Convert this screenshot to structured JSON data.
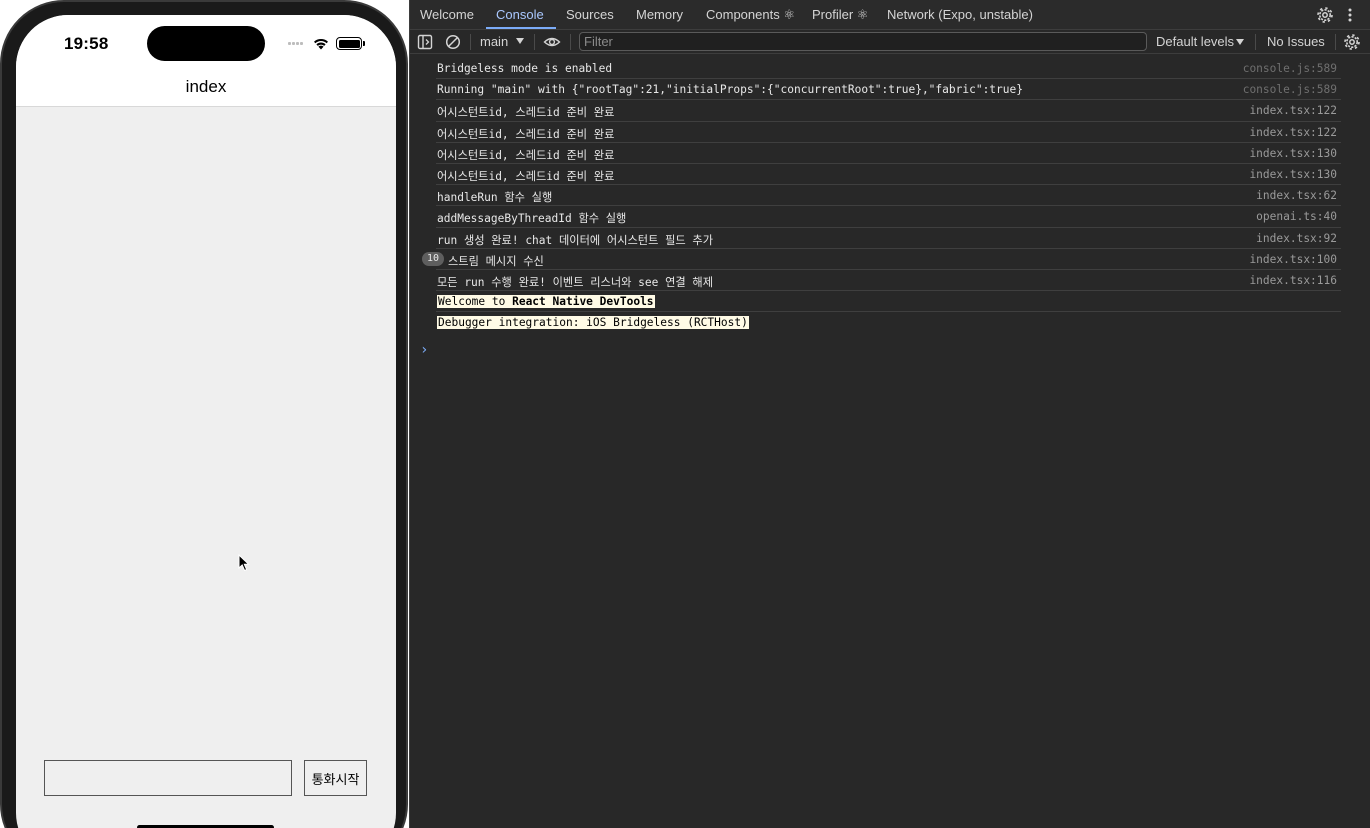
{
  "simulator": {
    "time": "19:58",
    "screen_title": "index",
    "input_value": "",
    "call_button_label": "통화시작"
  },
  "devtools": {
    "tabs": [
      {
        "label": "Welcome",
        "active": false
      },
      {
        "label": "Console",
        "active": true
      },
      {
        "label": "Sources",
        "active": false
      },
      {
        "label": "Memory",
        "active": false
      },
      {
        "label": "Components ⚛",
        "active": false
      },
      {
        "label": "Profiler ⚛",
        "active": false
      },
      {
        "label": "Network (Expo, unstable)",
        "active": false
      }
    ],
    "toolbar": {
      "context": "main",
      "filter_placeholder": "Filter",
      "levels": "Default levels",
      "issues": "No Issues"
    },
    "logs": [
      {
        "message": "Bridgeless mode is enabled",
        "source": "console.js:589"
      },
      {
        "message": "Running \"main\" with {\"rootTag\":21,\"initialProps\":{\"concurrentRoot\":true},\"fabric\":true}",
        "source": "console.js:589"
      },
      {
        "message": "어시스턴트id, 스레드id 준비 완료",
        "source": "index.tsx:122"
      },
      {
        "message": "어시스턴트id, 스레드id 준비 완료",
        "source": "index.tsx:122"
      },
      {
        "message": "어시스턴트id, 스레드id 준비 완료",
        "source": "index.tsx:130"
      },
      {
        "message": "어시스턴트id, 스레드id 준비 완료",
        "source": "index.tsx:130"
      },
      {
        "message": "handleRun 함수 실행",
        "source": "index.tsx:62"
      },
      {
        "message": "addMessageByThreadId 함수 실행",
        "source": "openai.ts:40"
      },
      {
        "message": "run 생성 완료! chat 데이터에 어시스턴트 필드 추가",
        "source": "index.tsx:92"
      },
      {
        "message": "스트림 메시지 수신",
        "source": "index.tsx:100",
        "repeat": "10"
      },
      {
        "message": "모든 run 수행 완료! 이벤트 리스너와 see 연결 해제",
        "source": "index.tsx:116"
      }
    ],
    "welcome": {
      "prefix": "Welcome to ",
      "bold": "React Native DevTools"
    },
    "debugger_line": "Debugger integration: iOS Bridgeless (RCTHost)",
    "prompt": "›"
  }
}
